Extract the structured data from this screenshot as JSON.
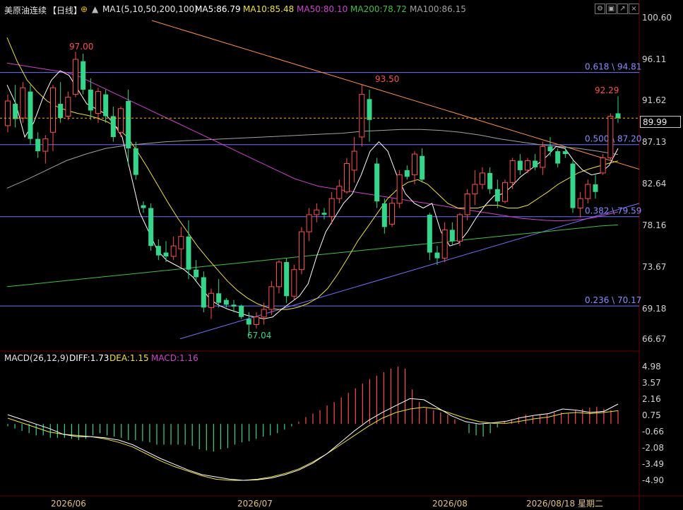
{
  "header": {
    "title": "美原油连续",
    "period": "【日线】",
    "ma_params": "MA1(5,10,50,200,100)",
    "ma5": "MA5:86.79",
    "ma10": "MA10:85.48",
    "ma50": "MA50:80.10",
    "ma200": "MA200:78.72",
    "ma100": "MA100:86.15"
  },
  "colors": {
    "up": "#ff4d4d",
    "down": "#33d68a",
    "ma5": "#ffffff",
    "ma10": "#f0e030",
    "ma50": "#d040d0",
    "ma200": "#40c040",
    "ma100": "#a0a0a0",
    "fib": "#7070ff",
    "resistance": "#ff9040",
    "support": "#7070ff",
    "dashed_price": "#ffb000"
  },
  "price_axis": {
    "ticks": [
      "100.60",
      "96.11",
      "91.62",
      "87.13",
      "82.64",
      "78.16",
      "73.67",
      "69.18",
      "66.67"
    ],
    "current": "89.99"
  },
  "macd_header": {
    "label": "MACD(26,12,9)",
    "diff": "DIFF:1.73",
    "dea": "DEA:1.15",
    "macd": "MACD:1.16"
  },
  "macd_axis": {
    "ticks": [
      "4.98",
      "3.57",
      "2.16",
      "0.75",
      "-0.66",
      "-2.08",
      "-3.49",
      "-4.90"
    ]
  },
  "time_axis": {
    "labels": [
      "2026/06",
      "2026/07",
      "2026/08",
      "2026/08/18 星期二"
    ]
  },
  "annotations": {
    "high1": "97.00",
    "high2": "93.50",
    "high3": "92.29",
    "low1": "67.04"
  },
  "fib_levels": [
    {
      "label": "0.618 \\ 94.81",
      "price": 94.81
    },
    {
      "label": "0.500 \\ 87.20",
      "price": 87.2
    },
    {
      "label": "0.382 \\ 79.59",
      "price": 79.59
    },
    {
      "label": "0.236 \\ 70.17",
      "price": 70.17
    }
  ],
  "chart_data": {
    "type": "candlestick",
    "price_range": [
      66.67,
      100.6
    ],
    "candles": [
      {
        "o": 89.2,
        "h": 92.5,
        "l": 88.5,
        "c": 91.8
      },
      {
        "o": 91.5,
        "h": 93.5,
        "l": 89.0,
        "c": 89.9
      },
      {
        "o": 90.0,
        "h": 93.8,
        "l": 89.5,
        "c": 93.2
      },
      {
        "o": 92.8,
        "h": 93.5,
        "l": 87.2,
        "c": 87.8
      },
      {
        "o": 87.8,
        "h": 88.5,
        "l": 85.8,
        "c": 86.5
      },
      {
        "o": 86.5,
        "h": 88.2,
        "l": 85.2,
        "c": 87.8
      },
      {
        "o": 88.5,
        "h": 93.5,
        "l": 86.5,
        "c": 93.2
      },
      {
        "o": 91.5,
        "h": 93.8,
        "l": 89.5,
        "c": 90.0
      },
      {
        "o": 90.2,
        "h": 92.8,
        "l": 89.8,
        "c": 92.2
      },
      {
        "o": 92.5,
        "h": 97.0,
        "l": 92.2,
        "c": 96.2
      },
      {
        "o": 96.0,
        "h": 96.8,
        "l": 92.5,
        "c": 93.0
      },
      {
        "o": 93.0,
        "h": 94.2,
        "l": 89.8,
        "c": 90.8
      },
      {
        "o": 90.5,
        "h": 93.2,
        "l": 89.5,
        "c": 92.8
      },
      {
        "o": 92.5,
        "h": 93.0,
        "l": 89.5,
        "c": 90.2
      },
      {
        "o": 90.2,
        "h": 91.2,
        "l": 87.5,
        "c": 88.0
      },
      {
        "o": 88.5,
        "h": 91.2,
        "l": 88.0,
        "c": 91.0
      },
      {
        "o": 91.8,
        "h": 93.0,
        "l": 85.0,
        "c": 86.8
      },
      {
        "o": 86.8,
        "h": 87.5,
        "l": 83.5,
        "c": 84.0
      },
      {
        "o": 80.8,
        "h": 81.2,
        "l": 80.0,
        "c": 80.5
      },
      {
        "o": 80.5,
        "h": 81.0,
        "l": 76.0,
        "c": 76.5
      },
      {
        "o": 76.5,
        "h": 77.2,
        "l": 75.0,
        "c": 75.5
      },
      {
        "o": 75.8,
        "h": 77.0,
        "l": 74.8,
        "c": 75.4
      },
      {
        "o": 75.4,
        "h": 77.5,
        "l": 75.0,
        "c": 76.5
      },
      {
        "o": 76.2,
        "h": 78.5,
        "l": 74.2,
        "c": 77.5
      },
      {
        "o": 77.5,
        "h": 79.2,
        "l": 73.0,
        "c": 74.0
      },
      {
        "o": 74.0,
        "h": 75.0,
        "l": 72.8,
        "c": 73.2
      },
      {
        "o": 73.2,
        "h": 73.8,
        "l": 69.5,
        "c": 70.0
      },
      {
        "o": 70.0,
        "h": 72.0,
        "l": 68.8,
        "c": 71.5
      },
      {
        "o": 71.5,
        "h": 73.0,
        "l": 70.0,
        "c": 70.5
      },
      {
        "o": 70.8,
        "h": 71.0,
        "l": 70.0,
        "c": 70.3
      },
      {
        "o": 70.3,
        "h": 70.8,
        "l": 69.5,
        "c": 70.1
      },
      {
        "o": 70.2,
        "h": 70.3,
        "l": 68.8,
        "c": 69.0
      },
      {
        "o": 68.8,
        "h": 69.5,
        "l": 67.04,
        "c": 68.2
      },
      {
        "o": 68.2,
        "h": 69.5,
        "l": 67.8,
        "c": 69.0
      },
      {
        "o": 69.0,
        "h": 70.5,
        "l": 68.2,
        "c": 69.8
      },
      {
        "o": 69.8,
        "h": 72.8,
        "l": 69.2,
        "c": 72.2
      },
      {
        "o": 72.2,
        "h": 75.0,
        "l": 71.5,
        "c": 74.8
      },
      {
        "o": 74.8,
        "h": 75.2,
        "l": 70.5,
        "c": 71.2
      },
      {
        "o": 71.2,
        "h": 74.5,
        "l": 70.8,
        "c": 74.0
      },
      {
        "o": 74.0,
        "h": 78.5,
        "l": 73.5,
        "c": 78.0
      },
      {
        "o": 78.0,
        "h": 80.5,
        "l": 77.0,
        "c": 79.8
      },
      {
        "o": 79.8,
        "h": 81.0,
        "l": 79.0,
        "c": 80.3
      },
      {
        "o": 80.0,
        "h": 80.5,
        "l": 79.3,
        "c": 79.8
      },
      {
        "o": 79.6,
        "h": 82.2,
        "l": 78.8,
        "c": 81.5
      },
      {
        "o": 81.5,
        "h": 83.5,
        "l": 81.0,
        "c": 82.8
      },
      {
        "o": 82.2,
        "h": 85.8,
        "l": 82.0,
        "c": 85.2
      },
      {
        "o": 84.5,
        "h": 88.0,
        "l": 83.2,
        "c": 86.5
      },
      {
        "o": 88.0,
        "h": 93.5,
        "l": 87.0,
        "c": 92.5
      },
      {
        "o": 92.0,
        "h": 93.0,
        "l": 87.5,
        "c": 89.8
      },
      {
        "o": 85.2,
        "h": 85.8,
        "l": 80.5,
        "c": 81.2
      },
      {
        "o": 81.0,
        "h": 81.5,
        "l": 77.8,
        "c": 78.5
      },
      {
        "o": 78.8,
        "h": 81.5,
        "l": 78.5,
        "c": 81.0
      },
      {
        "o": 81.0,
        "h": 84.5,
        "l": 80.5,
        "c": 84.0
      },
      {
        "o": 84.5,
        "h": 85.0,
        "l": 83.5,
        "c": 83.8
      },
      {
        "o": 84.0,
        "h": 86.5,
        "l": 83.0,
        "c": 86.2
      },
      {
        "o": 86.0,
        "h": 86.8,
        "l": 83.2,
        "c": 83.5
      },
      {
        "o": 79.8,
        "h": 80.0,
        "l": 75.0,
        "c": 75.8
      },
      {
        "o": 75.8,
        "h": 76.5,
        "l": 74.5,
        "c": 75.2
      },
      {
        "o": 75.2,
        "h": 79.0,
        "l": 74.8,
        "c": 78.2
      },
      {
        "o": 78.2,
        "h": 79.0,
        "l": 76.5,
        "c": 77.0
      },
      {
        "o": 77.0,
        "h": 80.0,
        "l": 76.5,
        "c": 79.8
      },
      {
        "o": 79.8,
        "h": 82.5,
        "l": 79.2,
        "c": 82.0
      },
      {
        "o": 82.0,
        "h": 84.5,
        "l": 80.8,
        "c": 83.0
      },
      {
        "o": 83.0,
        "h": 84.8,
        "l": 82.5,
        "c": 84.2
      },
      {
        "o": 84.2,
        "h": 84.8,
        "l": 82.0,
        "c": 82.5
      },
      {
        "o": 82.5,
        "h": 83.5,
        "l": 80.5,
        "c": 81.2
      },
      {
        "o": 81.2,
        "h": 83.5,
        "l": 81.0,
        "c": 83.2
      },
      {
        "o": 83.2,
        "h": 85.8,
        "l": 82.5,
        "c": 85.5
      },
      {
        "o": 85.5,
        "h": 86.2,
        "l": 84.0,
        "c": 84.5
      },
      {
        "o": 84.5,
        "h": 85.8,
        "l": 84.2,
        "c": 85.5
      },
      {
        "o": 85.5,
        "h": 86.2,
        "l": 84.5,
        "c": 84.8
      },
      {
        "o": 84.8,
        "h": 87.5,
        "l": 84.0,
        "c": 87.0
      },
      {
        "o": 87.0,
        "h": 88.0,
        "l": 86.0,
        "c": 86.5
      },
      {
        "o": 86.5,
        "h": 86.8,
        "l": 84.8,
        "c": 85.2
      },
      {
        "o": 86.5,
        "h": 87.0,
        "l": 85.8,
        "c": 86.2
      },
      {
        "o": 85.2,
        "h": 85.5,
        "l": 80.0,
        "c": 80.5
      },
      {
        "o": 80.5,
        "h": 82.2,
        "l": 79.5,
        "c": 81.5
      },
      {
        "o": 81.5,
        "h": 83.5,
        "l": 81.0,
        "c": 83.0
      },
      {
        "o": 83.0,
        "h": 84.0,
        "l": 81.5,
        "c": 82.2
      },
      {
        "o": 84.2,
        "h": 86.2,
        "l": 84.0,
        "c": 85.8
      },
      {
        "o": 85.8,
        "h": 90.5,
        "l": 85.5,
        "c": 90.2
      },
      {
        "o": 90.5,
        "h": 92.29,
        "l": 89.5,
        "c": 89.99
      }
    ],
    "ma5": [
      93.5,
      91.5,
      88.0,
      89.5,
      92.0,
      94.0,
      95.0,
      94.5,
      93.0,
      91.5,
      91.0,
      90.5,
      89.5,
      88.0,
      84.0,
      80.0,
      78.0,
      76.0,
      75.0,
      74.5,
      74.0,
      73.2,
      72.0,
      70.8,
      70.2,
      69.8,
      69.5,
      69.2,
      69.0,
      68.8,
      69.0,
      69.8,
      70.5,
      71.2,
      72.5,
      75.5,
      78.0,
      79.5,
      81.0,
      82.0,
      84.0,
      86.5,
      87.5,
      86.5,
      84.0,
      82.0,
      81.0,
      80.5,
      81.0,
      78.0,
      76.5,
      76.8,
      78.0,
      79.5,
      80.8,
      81.8,
      82.0,
      82.8,
      83.8,
      84.5,
      85.2,
      86.0,
      87.0,
      86.8,
      85.5,
      84.5,
      84.0,
      84.2,
      85.0,
      86.8
    ],
    "ma10": [
      98.5,
      96.0,
      94.0,
      92.8,
      91.8,
      91.2,
      90.8,
      90.5,
      90.3,
      90.0,
      89.6,
      89.0,
      88.0,
      86.5,
      84.8,
      83.0,
      81.2,
      79.5,
      78.0,
      76.5,
      75.2,
      74.0,
      72.8,
      71.8,
      71.0,
      70.4,
      70.0,
      69.8,
      69.8,
      70.0,
      70.4,
      71.0,
      72.0,
      73.5,
      75.2,
      77.0,
      78.5,
      80.0,
      81.5,
      82.5,
      83.2,
      83.5,
      83.0,
      82.0,
      81.0,
      80.5,
      80.5,
      80.5,
      80.8,
      80.8,
      80.5,
      80.5,
      80.8,
      81.5,
      82.2,
      83.0,
      83.6,
      84.2,
      84.6,
      84.9,
      85.2,
      85.48
    ],
    "ma50": [
      95.8,
      95.6,
      95.4,
      95.2,
      95.0,
      94.8,
      94.4,
      93.8,
      93.2,
      92.6,
      92.0,
      91.4,
      90.8,
      90.2,
      89.6,
      89.0,
      88.4,
      87.8,
      87.2,
      86.6,
      86.0,
      85.4,
      84.8,
      84.2,
      83.6,
      83.2,
      82.8,
      82.6,
      82.4,
      82.2,
      82.0,
      81.8,
      81.6,
      81.4,
      81.2,
      81.0,
      80.8,
      80.6,
      80.4,
      80.2,
      80.0,
      79.8,
      79.6,
      79.4,
      79.3,
      79.2,
      79.15,
      79.2,
      79.3,
      79.5,
      79.8,
      80.1
    ],
    "ma200": [
      72.2,
      72.4,
      72.6,
      72.8,
      73.0,
      73.2,
      73.4,
      73.6,
      73.8,
      74.0,
      74.2,
      74.4,
      74.6,
      74.8,
      75.0,
      75.2,
      75.4,
      75.6,
      75.8,
      76.0,
      76.2,
      76.4,
      76.6,
      76.8,
      77.0,
      77.2,
      77.4,
      77.6,
      77.8,
      78.0,
      78.2,
      78.4,
      78.6,
      78.72
    ],
    "ma100": [
      82.6,
      83.5,
      84.5,
      85.5,
      86.2,
      86.8,
      87.1,
      87.3,
      87.5,
      87.6,
      87.7,
      87.8,
      87.9,
      88.0,
      88.1,
      88.2,
      88.3,
      88.4,
      88.6,
      88.7,
      88.8,
      88.8,
      88.7,
      88.5,
      88.2,
      87.8,
      87.5,
      87.2,
      87.0,
      86.8,
      86.5,
      86.15
    ],
    "macd_range": [
      -4.9,
      4.98
    ],
    "macd_hist": [
      -0.2,
      -0.4,
      -0.6,
      -0.8,
      -1.0,
      -1.0,
      -1.2,
      -1.2,
      -1.2,
      -1.3,
      -1.4,
      -1.3,
      -1.0,
      -0.8,
      -1.0,
      -1.1,
      -1.2,
      -1.4,
      -1.4,
      -1.5,
      -1.6,
      -1.8,
      -1.8,
      -1.8,
      -1.8,
      -1.8,
      -1.9,
      -2.2,
      -2.3,
      -2.4,
      -2.2,
      -2.1,
      -1.8,
      -1.6,
      -1.5,
      -1.3,
      -1.1,
      -1.0,
      -0.8,
      -0.5,
      -0.2,
      0.2,
      0.6,
      0.9,
      1.2,
      1.6,
      1.9,
      2.3,
      2.7,
      3.1,
      3.5,
      3.9,
      4.2,
      4.5,
      4.8,
      4.98,
      4.8,
      3.0,
      1.9,
      1.4,
      1.2,
      1.0,
      0.8,
      0.4,
      0.0,
      -0.8,
      -1.0,
      -1.1,
      -0.8,
      -0.3,
      0.2,
      0.4,
      0.6,
      0.8,
      0.7,
      0.8,
      0.9,
      1.0,
      1.0,
      0.9,
      1.2,
      1.3,
      1.4,
      1.5,
      1.3,
      1.2,
      1.16
    ],
    "macd_diff": [
      0.8,
      0.4,
      0.0,
      -0.4,
      -0.9,
      -1.1,
      -1.1,
      -1.2,
      -1.4,
      -1.8,
      -2.4,
      -3.0,
      -3.5,
      -4.0,
      -4.4,
      -4.6,
      -4.8,
      -4.9,
      -4.85,
      -4.7,
      -4.4,
      -4.0,
      -3.4,
      -2.6,
      -1.6,
      -0.6,
      0.3,
      1.0,
      1.6,
      2.2,
      2.1,
      1.4,
      0.7,
      0.2,
      0.0,
      0.1,
      0.25,
      0.55,
      0.75,
      0.9,
      1.3,
      1.2,
      1.0,
      1.1,
      1.73
    ],
    "macd_dea": [
      0.5,
      0.1,
      -0.3,
      -0.7,
      -0.9,
      -1.0,
      -1.1,
      -1.3,
      -1.6,
      -2.0,
      -2.6,
      -3.2,
      -3.7,
      -4.1,
      -4.5,
      -4.8,
      -4.9,
      -4.9,
      -4.8,
      -4.6,
      -4.3,
      -3.9,
      -3.3,
      -2.6,
      -1.8,
      -1.0,
      -0.2,
      0.5,
      1.0,
      1.3,
      1.45,
      1.3,
      0.9,
      0.5,
      0.2,
      0.05,
      0.05,
      0.25,
      0.45,
      0.6,
      0.9,
      1.0,
      0.9,
      1.0,
      1.15
    ]
  }
}
